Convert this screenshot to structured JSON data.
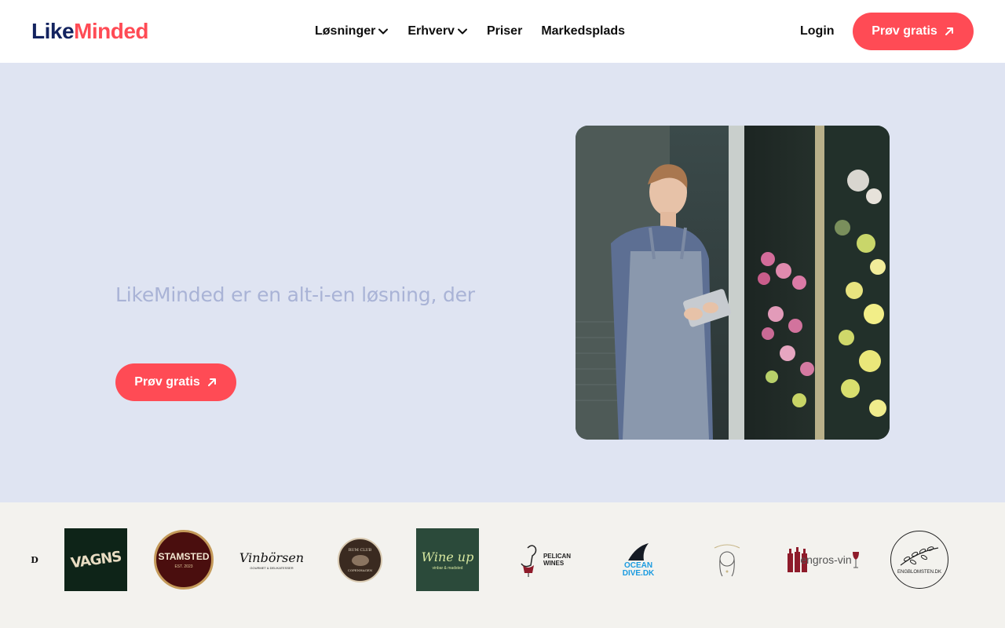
{
  "header": {
    "logo": {
      "part1": "Like",
      "part2": "Minded"
    },
    "nav": [
      {
        "label": "Løsninger",
        "has_dropdown": true
      },
      {
        "label": "Erhverv",
        "has_dropdown": true
      },
      {
        "label": "Priser",
        "has_dropdown": false
      },
      {
        "label": "Markedsplads",
        "has_dropdown": false
      }
    ],
    "login_label": "Login",
    "cta_label": "Prøv gratis"
  },
  "hero": {
    "text": "LikeMinded er en alt-i-en løsning, der",
    "cta_label": "Prøv gratis"
  },
  "logos": {
    "partial_first": "D",
    "items": [
      {
        "text": "VAGNS"
      },
      {
        "text": "STAMSTED",
        "subtext": "EST. 2023"
      },
      {
        "text": "Vinbörsen",
        "subtext": "GOURMET & DELIKATESSER"
      },
      {
        "text": "RUM CLUB",
        "subtext": "COPENHAGEN"
      },
      {
        "text": "Wine up",
        "subtext": "vinbar & madsted"
      },
      {
        "text": "PELICAN",
        "subtext": "WINES"
      },
      {
        "text": "OCEAN",
        "subtext": "DIVE.DK"
      },
      {
        "text": ""
      },
      {
        "text": "engros-vin"
      },
      {
        "text": "ENGBLOMSTEN.DK"
      }
    ]
  },
  "colors": {
    "brand_navy": "#13235f",
    "brand_coral": "#ff4b55",
    "hero_bg": "#dfe4f2",
    "hero_text": "#a9b3d6",
    "logos_bg": "#f3f2ee"
  }
}
